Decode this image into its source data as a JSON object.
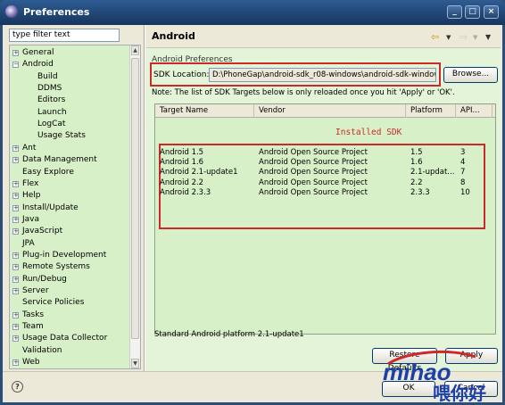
{
  "window": {
    "title": "Preferences",
    "minimize": "_",
    "maximize": "□",
    "close": "×"
  },
  "filter": {
    "value": "type filter text"
  },
  "tree": [
    {
      "label": "General",
      "indent": 0,
      "toggle": "+"
    },
    {
      "label": "Android",
      "indent": 0,
      "toggle": "−",
      "selected": true
    },
    {
      "label": "Build",
      "indent": 1
    },
    {
      "label": "DDMS",
      "indent": 1
    },
    {
      "label": "Editors",
      "indent": 1
    },
    {
      "label": "Launch",
      "indent": 1
    },
    {
      "label": "LogCat",
      "indent": 1
    },
    {
      "label": "Usage Stats",
      "indent": 1
    },
    {
      "label": "Ant",
      "indent": 0,
      "toggle": "+"
    },
    {
      "label": "Data Management",
      "indent": 0,
      "toggle": "+"
    },
    {
      "label": "Easy Explore",
      "indent": 0
    },
    {
      "label": "Flex",
      "indent": 0,
      "toggle": "+"
    },
    {
      "label": "Help",
      "indent": 0,
      "toggle": "+"
    },
    {
      "label": "Install/Update",
      "indent": 0,
      "toggle": "+"
    },
    {
      "label": "Java",
      "indent": 0,
      "toggle": "+"
    },
    {
      "label": "JavaScript",
      "indent": 0,
      "toggle": "+"
    },
    {
      "label": "JPA",
      "indent": 0
    },
    {
      "label": "Plug-in Development",
      "indent": 0,
      "toggle": "+"
    },
    {
      "label": "Remote Systems",
      "indent": 0,
      "toggle": "+"
    },
    {
      "label": "Run/Debug",
      "indent": 0,
      "toggle": "+"
    },
    {
      "label": "Server",
      "indent": 0,
      "toggle": "+"
    },
    {
      "label": "Service Policies",
      "indent": 0
    },
    {
      "label": "Tasks",
      "indent": 0,
      "toggle": "+"
    },
    {
      "label": "Team",
      "indent": 0,
      "toggle": "+"
    },
    {
      "label": "Usage Data Collector",
      "indent": 0,
      "toggle": "+"
    },
    {
      "label": "Validation",
      "indent": 0
    },
    {
      "label": "Web",
      "indent": 0,
      "toggle": "+"
    }
  ],
  "page": {
    "title": "Android",
    "section": "Android Preferences",
    "sdk_label": "SDK Location:",
    "sdk_value": "D:\\PhoneGap\\android-sdk_r08-windows\\android-sdk-windows",
    "browse": "Browse...",
    "note": "Note: The list of SDK Targets below is only reloaded once you hit 'Apply' or 'OK'.",
    "columns": [
      "Target Name",
      "Vendor",
      "Platform",
      "API..."
    ],
    "rows": [
      [
        "Android 1.5",
        "Android Open Source Project",
        "1.5",
        "3"
      ],
      [
        "Android 1.6",
        "Android Open Source Project",
        "1.6",
        "4"
      ],
      [
        "Android 2.1-update1",
        "Android Open Source Project",
        "2.1-updat...",
        "7"
      ],
      [
        "Android 2.2",
        "Android Open Source Project",
        "2.2",
        "8"
      ],
      [
        "Android 2.3.3",
        "Android Open Source Project",
        "2.3.3",
        "10"
      ]
    ],
    "annotation": "Installed SDK",
    "status": "Standard Android platform 2.1-update1",
    "restore": "Restore Defaults",
    "apply": "Apply"
  },
  "footer": {
    "help": "?",
    "ok": "OK",
    "cancel": "Cancel"
  },
  "watermark": {
    "text": "mihao",
    "cn": "喂你好"
  },
  "colors": {
    "tree_bg": "#d8f0c8",
    "highlight": "#cc2a2a",
    "titlebar": "#2e5c93"
  }
}
